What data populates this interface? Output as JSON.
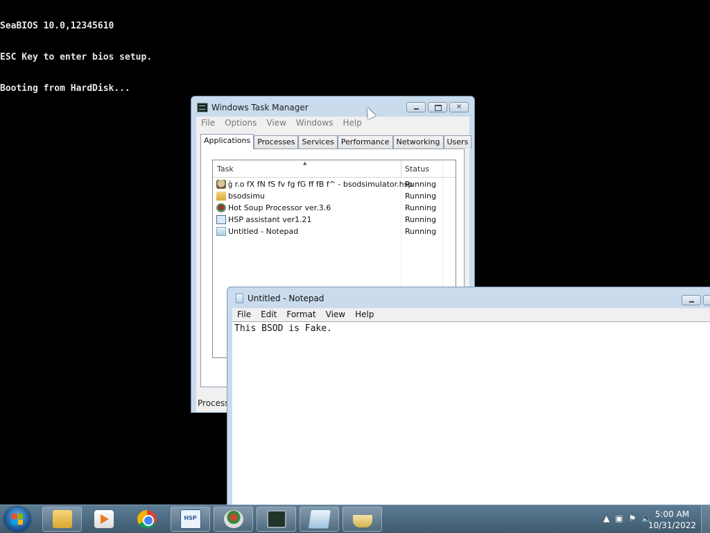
{
  "bios": {
    "lines": [
      "SeaBIOS 10.0,12345610",
      "ESC Key to enter bios setup.",
      "Booting from HardDisk..."
    ]
  },
  "task_manager": {
    "title": "Windows Task Manager",
    "menu": [
      "File",
      "Options",
      "View",
      "Windows",
      "Help"
    ],
    "tabs": [
      "Applications",
      "Processes",
      "Services",
      "Performance",
      "Networking",
      "Users"
    ],
    "active_tab": "Applications",
    "columns": {
      "task": "Task",
      "status": "Status"
    },
    "rows": [
      {
        "task": "g͐ r.o fX fN fS fv fg fG ff fB f^ - bsodsimulator.hsp",
        "status": "Running",
        "icon": "app-icon"
      },
      {
        "task": "bsodsimu",
        "status": "Running",
        "icon": "folder-icon"
      },
      {
        "task": "Hot Soup Processor ver.3.6",
        "status": "Running",
        "icon": "soup-icon"
      },
      {
        "task": "HSP assistant ver1.21",
        "status": "Running",
        "icon": "hsp-icon"
      },
      {
        "task": "Untitled - Notepad",
        "status": "Running",
        "icon": "notepad-icon"
      }
    ],
    "status_bar": "Processe"
  },
  "notepad": {
    "title": "Untitled - Notepad",
    "menu": [
      "File",
      "Edit",
      "Format",
      "View",
      "Help"
    ],
    "content": "This BSOD is Fake."
  },
  "taskbar": {
    "items": [
      "windows-explorer",
      "media-player",
      "chrome",
      "hsp-assistant",
      "hot-soup-processor",
      "task-manager",
      "notepad",
      "java-app"
    ],
    "clock_time": "5:00 AM",
    "clock_date": "10/31/2022"
  }
}
